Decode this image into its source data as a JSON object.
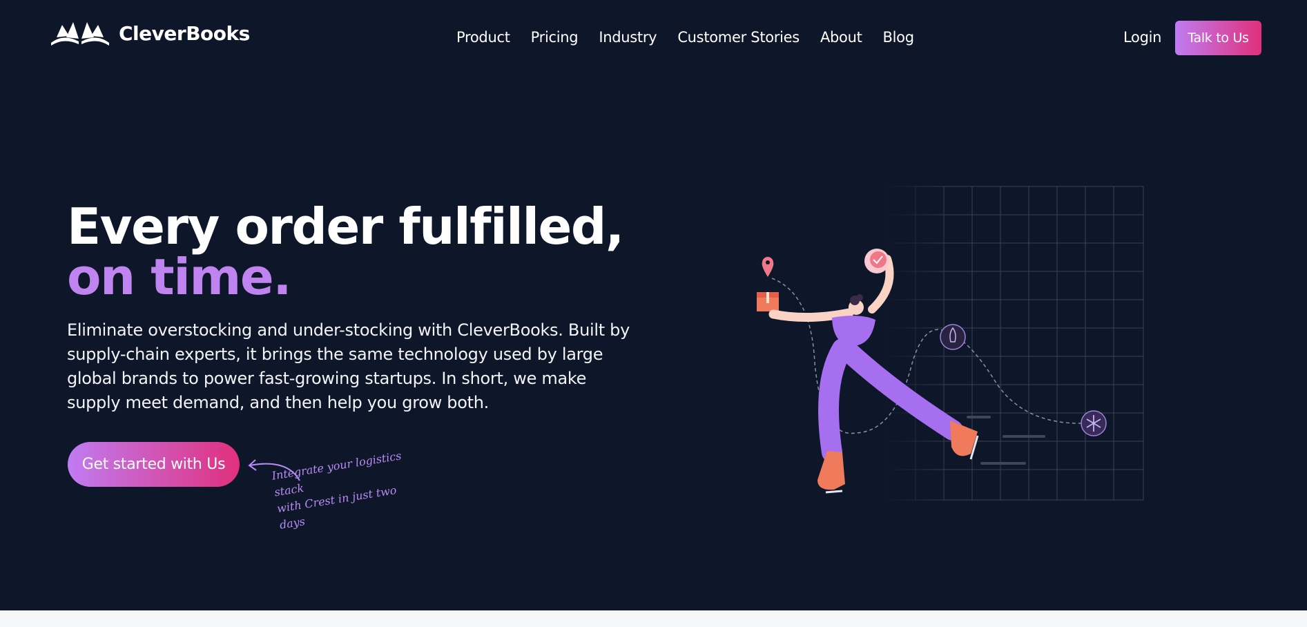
{
  "brand": {
    "name": "CleverBooks"
  },
  "nav": {
    "items": [
      "Product",
      "Pricing",
      "Industry",
      "Customer Stories",
      "About",
      "Blog"
    ],
    "login_label": "Login",
    "talk_label": "Talk to Us"
  },
  "hero": {
    "title_main": "Every order fulfilled, ",
    "title_accent": "on time.",
    "subtitle": "Eliminate overstocking and under-stocking with CleverBooks. Built by supply-chain experts, it brings the same technology used by large global brands to power fast-growing startups. In short, we make supply meet demand, and then help you grow both.",
    "cta_label": "Get started with Us",
    "note_line1": "Integrate your logistics stack",
    "note_line2": "with Crest in just two days"
  },
  "colors": {
    "background": "#0e1629",
    "accent": "#c084f0",
    "gradient_start": "#c07cf2",
    "gradient_end": "#e0307c"
  },
  "icons": [
    "open-book-logo-icon",
    "arrow-curved-icon",
    "location-pin-icon",
    "clock-icon",
    "rocket-icon",
    "snowflake-icon"
  ]
}
